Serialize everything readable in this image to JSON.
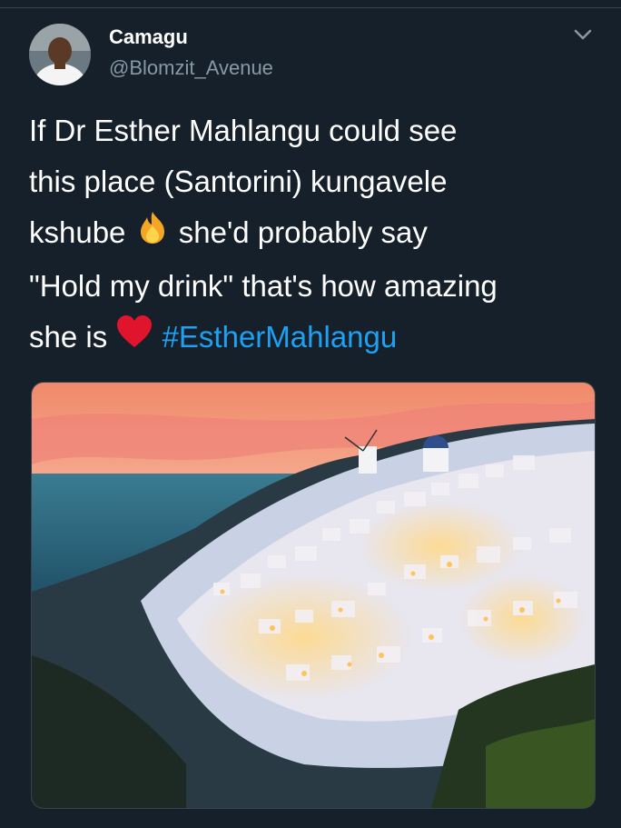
{
  "tweet": {
    "author_name": "Camagu",
    "author_handle": "@Blomzit_Avenue",
    "text_lines": [
      "If Dr Esther Mahlangu could see",
      "this place (Santorini)  kungavele",
      "kshube",
      "she'd probably say",
      "\"Hold my drink\" that's how amazing",
      "she is"
    ],
    "hashtag": "#EstherMahlangu",
    "emojis": [
      "fire-emoji",
      "red-heart-emoji"
    ]
  },
  "icons": {
    "menu": "chevron-down-icon"
  },
  "colors": {
    "background": "#15202b",
    "hashtag": "#1da1f2",
    "handle": "#8899a6"
  }
}
